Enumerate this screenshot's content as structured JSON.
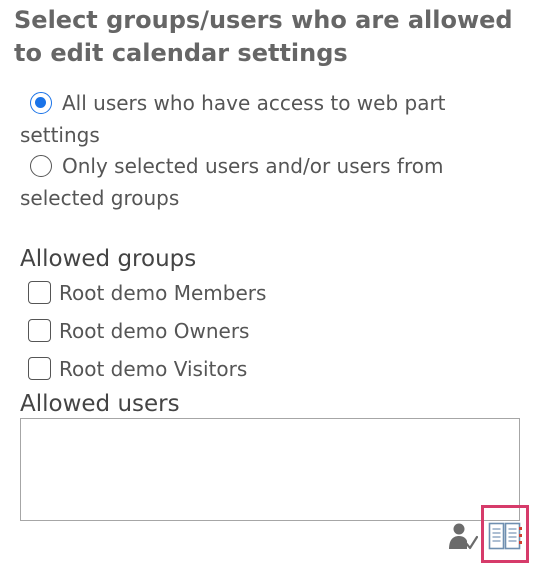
{
  "heading": "Select groups/users who are allowed to edit calendar settings",
  "permission_options": [
    {
      "label": "All users who have access to web part settings",
      "checked": true
    },
    {
      "label": "Only selected users and/or users from selected groups",
      "checked": false
    }
  ],
  "allowed_groups": {
    "label": "Allowed groups",
    "items": [
      {
        "label": "Root demo Members",
        "checked": false
      },
      {
        "label": "Root demo Owners",
        "checked": false
      },
      {
        "label": "Root demo Visitors",
        "checked": false
      }
    ]
  },
  "allowed_users": {
    "label": "Allowed users",
    "value": ""
  },
  "icons": {
    "check_names": "check-names-icon",
    "browse": "address-book-icon"
  },
  "colors": {
    "radio_accent": "#1a73e8",
    "highlight_border": "#d63b6a",
    "heading_text": "#666666"
  }
}
